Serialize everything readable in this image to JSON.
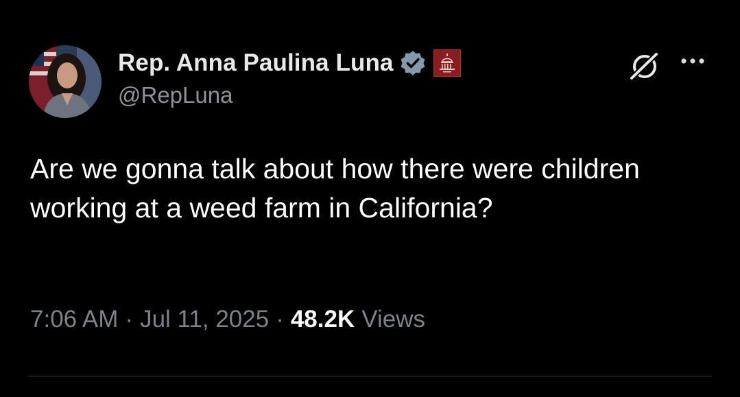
{
  "tweet": {
    "author": {
      "display_name": "Rep. Anna Paulina Luna",
      "handle": "@RepLuna",
      "verified_color": "#829aab",
      "affiliate_badge_color": "#8b1c1f"
    },
    "text": "Are we gonna talk about how there were children working at a weed farm in California?",
    "meta": {
      "time": "7:06 AM",
      "separator": "·",
      "date": "Jul 11, 2025",
      "views_count": "48.2K",
      "views_label": "Views"
    }
  },
  "icons": {
    "grok": "grok-icon",
    "more": "more-icon",
    "verified": "verified-badge-icon",
    "affiliate": "government-affiliate-icon"
  },
  "colors": {
    "background": "#000000",
    "primary_text": "#e7e9ea",
    "secondary_text": "#7b8389",
    "divider": "#3a3d40"
  }
}
